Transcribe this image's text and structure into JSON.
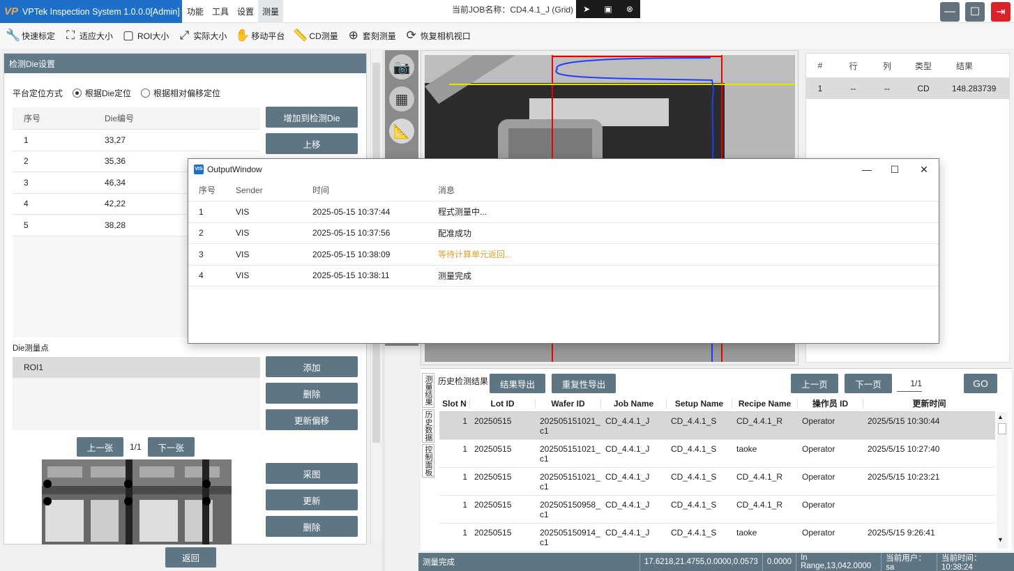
{
  "app": {
    "logo": "VP",
    "title": "VPTek Inspection System 1.0.0.0[Admin]",
    "menu": [
      "功能",
      "工具",
      "设置",
      "测量"
    ],
    "job_title": "当前JOB名称：CD4.4.1_J (Grid)"
  },
  "toolbar": {
    "items": [
      {
        "label": "快速标定",
        "icon": "wrench-icon"
      },
      {
        "label": "适应大小",
        "icon": "fit-icon"
      },
      {
        "label": "ROI大小",
        "icon": "rectangle-icon"
      },
      {
        "label": "实际大小",
        "icon": "expand-icon"
      },
      {
        "label": "移动平台",
        "icon": "hand-icon"
      },
      {
        "label": "CD测量",
        "icon": "ruler-icon"
      },
      {
        "label": "套刻测量",
        "icon": "plus-icon"
      },
      {
        "label": "恢复相机视口",
        "icon": "refresh-icon"
      }
    ]
  },
  "left": {
    "header": "检测Die设置",
    "position_label": "平台定位方式",
    "radio_die": "根据Die定位",
    "radio_offset": "根据相对偏移定位",
    "table_headers": [
      "序号",
      "Die编号"
    ],
    "rows": [
      {
        "no": "1",
        "die": "33,27"
      },
      {
        "no": "2",
        "die": "35,36"
      },
      {
        "no": "3",
        "die": "46,34"
      },
      {
        "no": "4",
        "die": "42,22"
      },
      {
        "no": "5",
        "die": "38,28"
      }
    ],
    "btn_add_die": "增加到检测Die",
    "btn_up": "上移",
    "measure_label": "Die测量点",
    "roi": "ROI1",
    "btn_add": "添加",
    "btn_delete": "删除",
    "btn_update_offset": "更新偏移",
    "btn_prev": "上一张",
    "page": "1/1",
    "btn_next": "下一张",
    "btn_capture": "采图",
    "btn_update": "更新",
    "btn_delete2": "删除",
    "btn_back": "返回"
  },
  "results": {
    "headers": [
      "#",
      "行",
      "列",
      "类型",
      "结果"
    ],
    "rows": [
      {
        "no": "1",
        "row": "--",
        "col": "--",
        "type": "CD",
        "result": "148.283739"
      }
    ]
  },
  "history": {
    "side_tabs": [
      "测量结果",
      "历史数据",
      "控制面板"
    ],
    "label": "历史检测结果",
    "btn_export": "结果导出",
    "btn_repeat_export": "重复性导出",
    "btn_prev": "上一页",
    "btn_next": "下一页",
    "page": "1/1",
    "btn_go": "GO",
    "headers": [
      "Slot N",
      "Lot ID",
      "Wafer ID",
      "Job Name",
      "Setup Name",
      "Recipe Name",
      "操作员 ID",
      "更新时间"
    ],
    "rows": [
      {
        "slot": "1",
        "lot": "20250515",
        "wafer": "202505151021_c1",
        "job": "CD_4.4.1_J",
        "setup": "CD_4.4.1_S",
        "recipe": "CD_4.4.1_R",
        "operator": "Operator",
        "time": "2025/5/15 10:30:44"
      },
      {
        "slot": "1",
        "lot": "20250515",
        "wafer": "202505151021_c1",
        "job": "CD_4.4.1_J",
        "setup": "CD_4.4.1_S",
        "recipe": "taoke",
        "operator": "Operator",
        "time": "2025/5/15 10:27:40"
      },
      {
        "slot": "1",
        "lot": "20250515",
        "wafer": "202505151021_c1",
        "job": "CD_4.4.1_J",
        "setup": "CD_4.4.1_S",
        "recipe": "CD_4.4.1_R",
        "operator": "Operator",
        "time": "2025/5/15 10:23:21"
      },
      {
        "slot": "1",
        "lot": "20250515",
        "wafer": "202505150958_c1",
        "job": "CD_4.4.1_J",
        "setup": "CD_4.4.1_S",
        "recipe": "CD_4.4.1_R",
        "operator": "Operator",
        "time": ""
      },
      {
        "slot": "1",
        "lot": "20250515",
        "wafer": "202505150914_c1",
        "job": "CD_4.4.1_J",
        "setup": "CD_4.4.1_S",
        "recipe": "taoke",
        "operator": "Operator",
        "time": "2025/5/15 9:26:41"
      }
    ]
  },
  "status": {
    "message": "测量完成",
    "coords": "17.6218,21.4755,0.0000,0.0573",
    "value": "0.0000",
    "range": "In Range,13,042.0000",
    "user": "当前用户：sa",
    "time": "当前时间：10:38:24"
  },
  "output_window": {
    "logo": "VIS",
    "title": "OutputWindow",
    "headers": [
      "序号",
      "Sender",
      "时间",
      "消息"
    ],
    "rows": [
      {
        "no": "1",
        "sender": "VIS",
        "time": "2025-05-15 10:37:44",
        "msg": "程式测量中...",
        "color": "#222222"
      },
      {
        "no": "2",
        "sender": "VIS",
        "time": "2025-05-15 10:37:56",
        "msg": "配准成功",
        "color": "#222222"
      },
      {
        "no": "3",
        "sender": "VIS",
        "time": "2025-05-15 10:38:09",
        "msg": "等待计算单元返回...",
        "color": "#e0a030"
      },
      {
        "no": "4",
        "sender": "VIS",
        "time": "2025-05-15 10:38:11",
        "msg": "测量完成",
        "color": "#222222"
      }
    ]
  },
  "colors": {
    "brand": "#1e6fc7",
    "button": "#5e7583",
    "header": "#607a8a",
    "close": "#d9222a"
  }
}
